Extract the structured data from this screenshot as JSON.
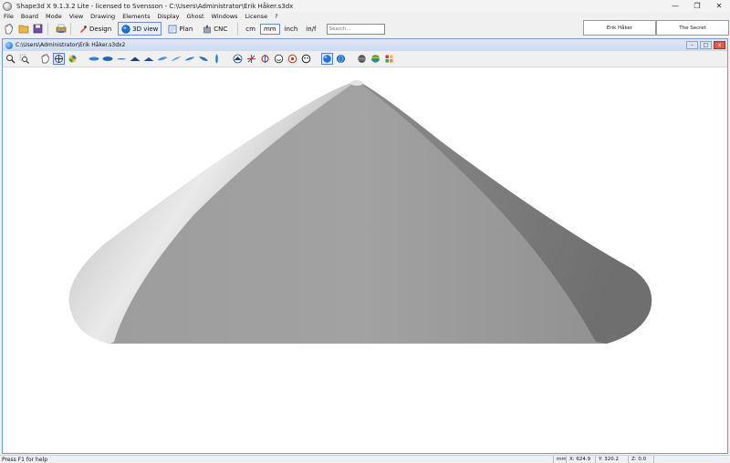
{
  "window": {
    "title": "Shape3d X 9.1.3.2 Lite - licensed to Svensson - C:\\Users\\Administrator\\Erik Håker.s3dx",
    "minimize": "—",
    "maximize": "❐",
    "close": "✕"
  },
  "menu": [
    "File",
    "Board",
    "Mode",
    "View",
    "Drawing",
    "Elements",
    "Display",
    "Ghost",
    "Windows",
    "License",
    "?"
  ],
  "toolbar": {
    "modes": [
      {
        "label": "Design",
        "active": false
      },
      {
        "label": "3D view",
        "active": true
      },
      {
        "label": "Plan",
        "active": false
      },
      {
        "label": "CNC",
        "active": false
      }
    ],
    "units": [
      {
        "label": "cm",
        "active": false
      },
      {
        "label": "mm",
        "active": true
      },
      {
        "label": "inch",
        "active": false
      },
      {
        "label": "in/f",
        "active": false
      }
    ],
    "search_placeholder": "Search..."
  },
  "board_tabs": [
    "Erik Håker",
    "The Secret"
  ],
  "document": {
    "title": "C:\\Users\\Administrator\\Erik Håker.s3dx2",
    "minimize": "–",
    "maximize": "□",
    "close": "x"
  },
  "colors": {
    "accent": "#5b7fc0",
    "board_light": "#d4d4d4",
    "board_mid": "#a4a4a4",
    "board_dark": "#7c7c7c"
  },
  "status": {
    "help": "Press F1 for help",
    "unit": "mm",
    "x": "X: 624.9",
    "y": "Y: 320.2",
    "z": "Z: 0.0"
  }
}
